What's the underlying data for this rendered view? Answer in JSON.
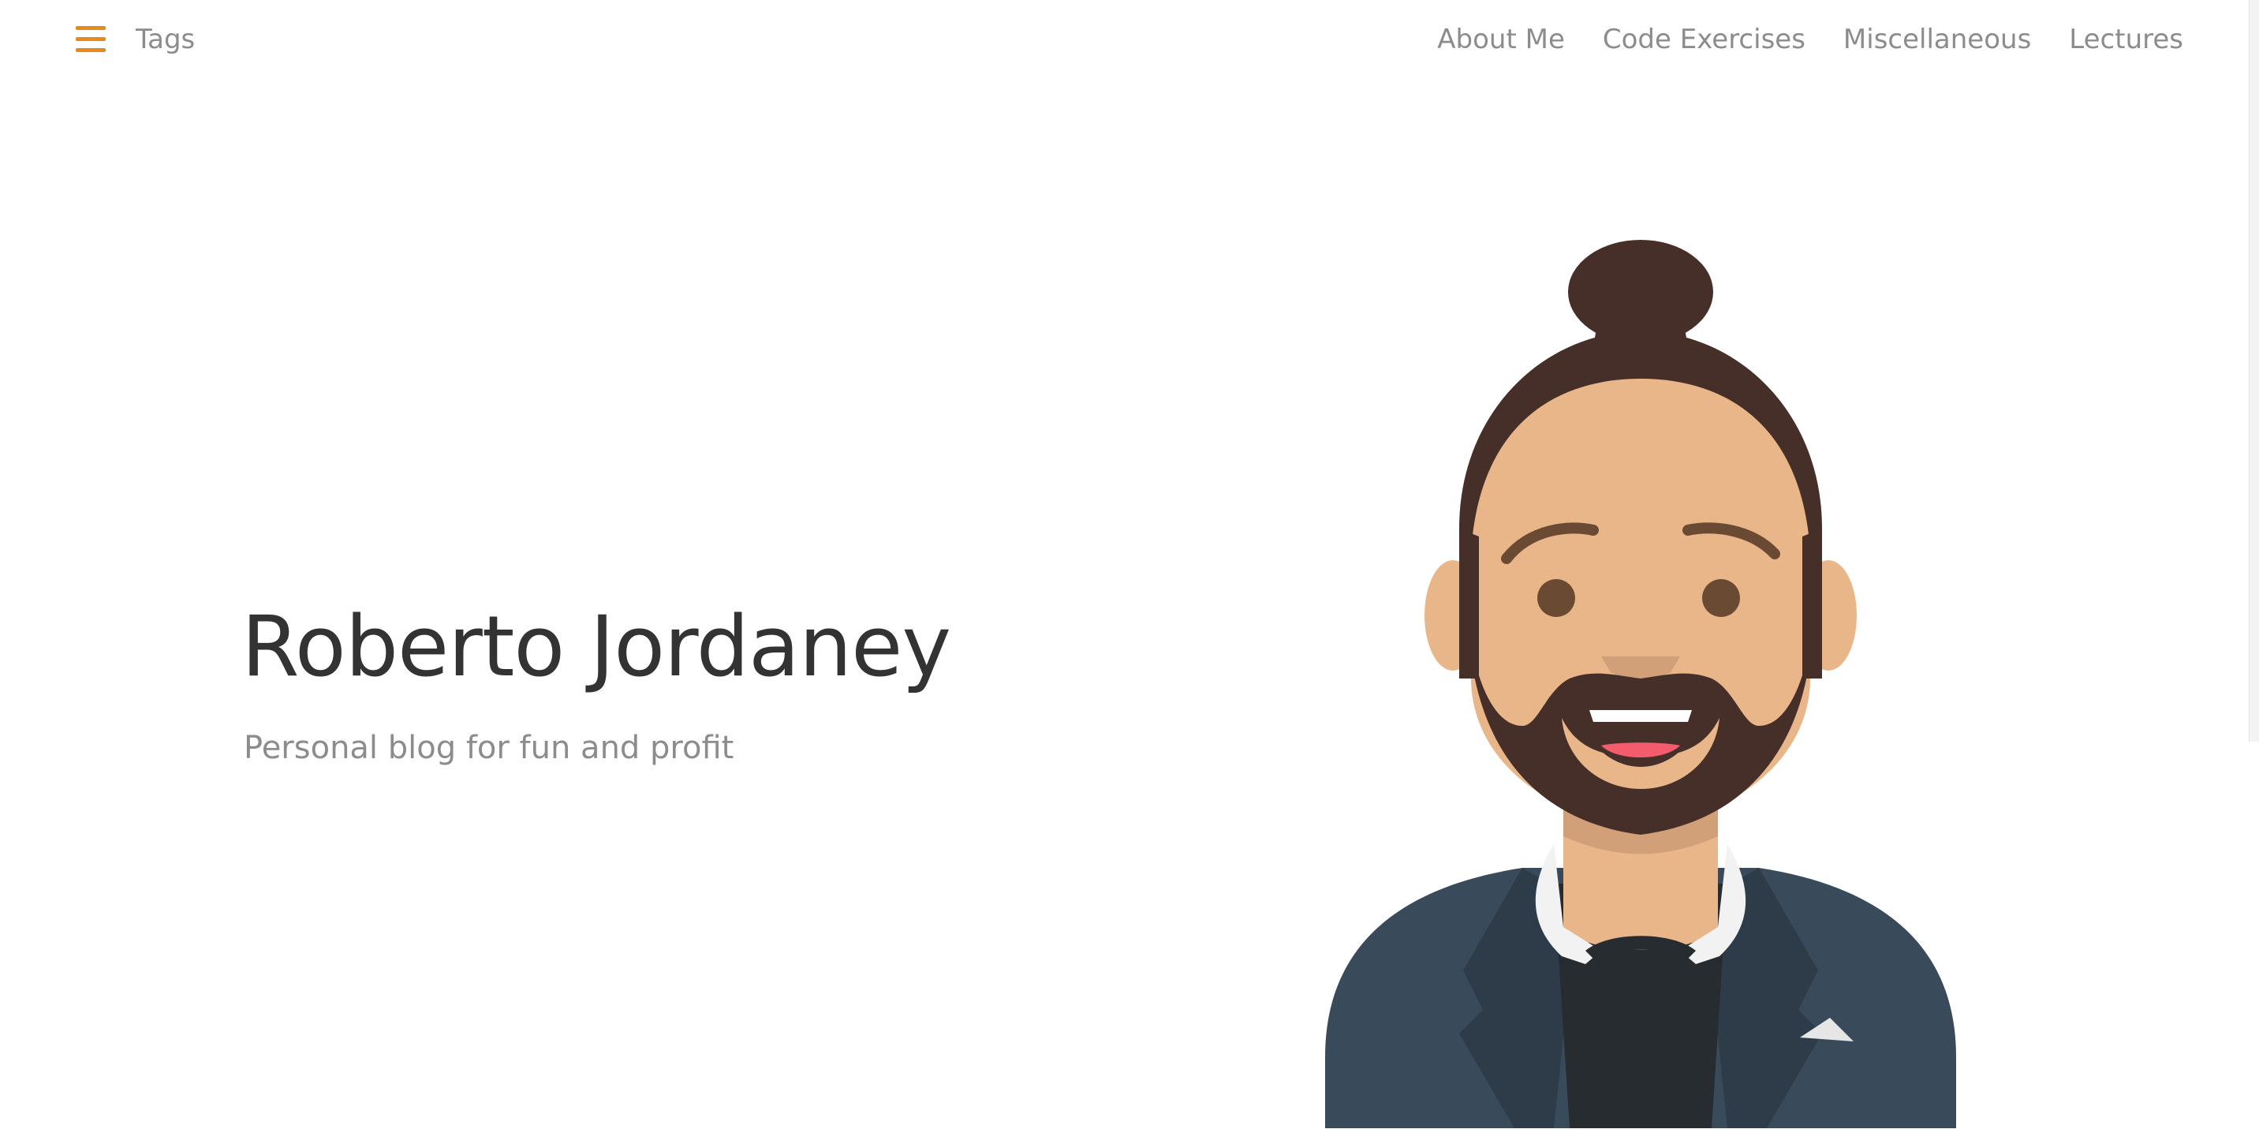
{
  "header": {
    "menu_icon": "hamburger-menu-icon",
    "tags_label": "Tags",
    "nav": [
      {
        "label": "About Me"
      },
      {
        "label": "Code Exercises"
      },
      {
        "label": "Miscellaneous"
      },
      {
        "label": "Lectures"
      }
    ],
    "accent_color": "#e8891c"
  },
  "hero": {
    "title": "Roberto Jordaney",
    "subtitle": "Personal blog for fun and profit",
    "avatar_icon": "bearded-man-avatar-illustration"
  },
  "colors": {
    "text_dark": "#333333",
    "text_muted": "#8c8c8c",
    "skin": "#e9b68a",
    "hair": "#472f29",
    "jacket": "#394a5a",
    "shirt": "#262c30"
  }
}
